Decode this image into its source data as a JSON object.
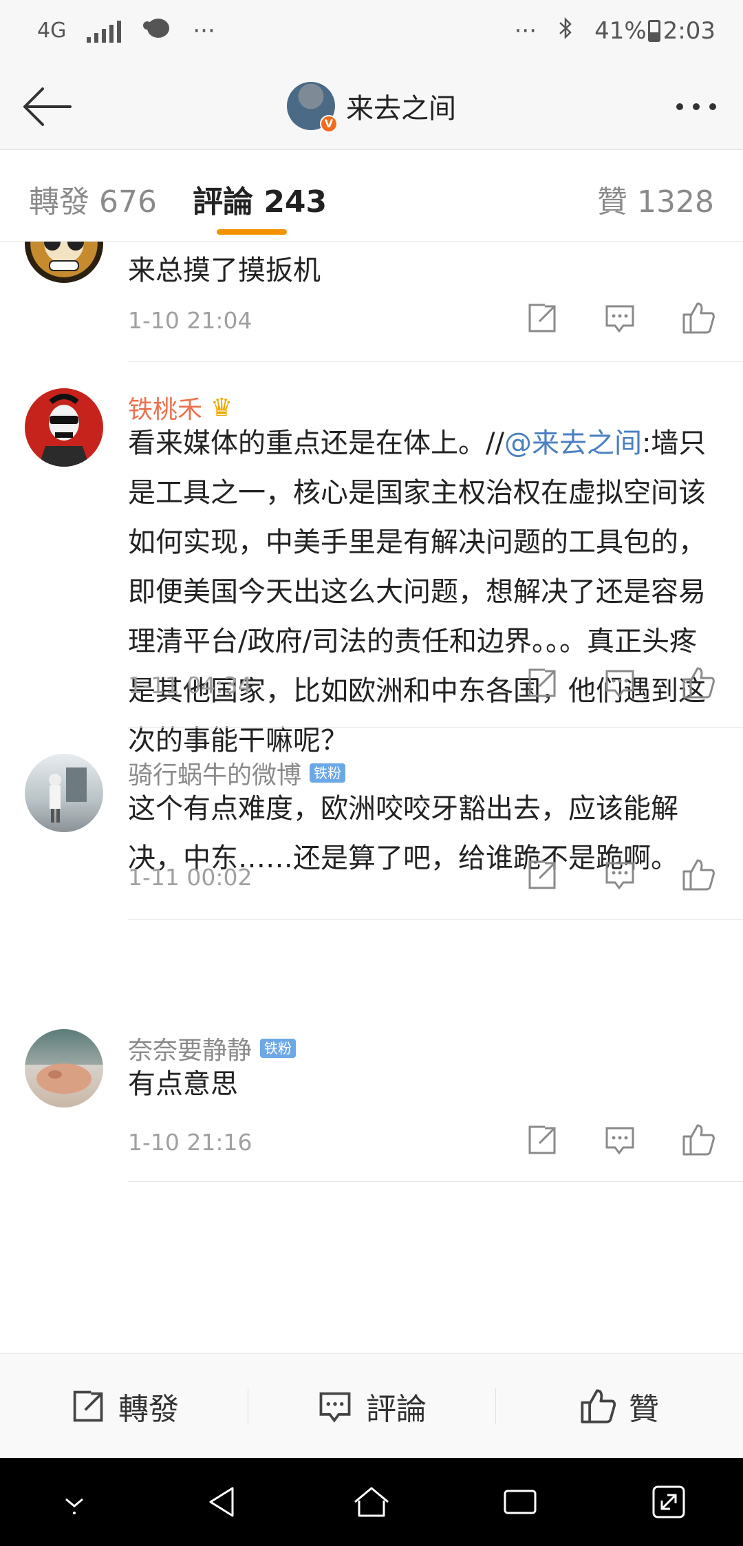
{
  "status_bar": {
    "network": "4G",
    "dots_left": "···",
    "dots_right": "···",
    "battery": "41%",
    "time": "2:03"
  },
  "nav": {
    "title": "来去之间",
    "verified_badge": "V"
  },
  "tabs": {
    "repost": "轉發 676",
    "comments": "評論 243",
    "likes": "贊 1328",
    "active_color": "#f39200"
  },
  "comments": [
    {
      "text": "来总摸了摸扳机",
      "time": "1-10 21:04"
    },
    {
      "name": "铁桃禾",
      "text_before": "看来媒体的重点还是在体上。//",
      "mention": "@来去之间",
      "text_after": ":墙只是工具之一，核心是国家主权治权在虚拟空间该如何实现，中美手里是有解决问题的工具包的，即便美国今天出这么大问题，想解决了还是容易理清平台/政府/司法的责任和边界。。。真正头疼是其他国家，比如欧洲和中东各国，他们遇到这次的事能干嘛呢？",
      "time": "1-11 04:34"
    },
    {
      "name": "骑行蜗牛的微博",
      "badge": "铁粉",
      "text": "这个有点难度，欧洲咬咬牙豁出去，应该能解决，中东……还是算了吧，给谁跪不是跪啊。",
      "time": "1-11 00:02"
    },
    {
      "name": "奈奈要静静",
      "badge": "铁粉",
      "text": "有点意思",
      "time": "1-10 21:16"
    }
  ],
  "bottom_bar": {
    "repost": "轉發",
    "comment": "評論",
    "like": "贊"
  },
  "colors": {
    "name_highlight": "#eb7350",
    "mention": "#4a7fc1",
    "fan_badge": "#6da8e6"
  }
}
